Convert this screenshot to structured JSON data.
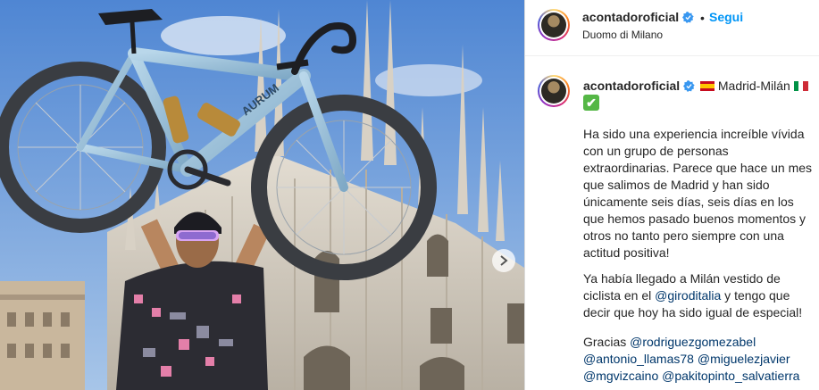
{
  "post": {
    "username": "acontadoroficial",
    "follow_label": "Segui",
    "separator": "•",
    "location": "Duomo di Milano"
  },
  "caption": {
    "username": "acontadoroficial",
    "title_text": "Madrid-Milán",
    "check_emoji": "✔",
    "paragraph1": "Ha sido una experiencia increíble vívida con un grupo de personas extraordinarias. Parece que hace un mes que salimos de Madrid y han sido únicamente seis días, seis días en los que hemos pasado buenos momentos y otros no tanto pero siempre con una actitud positiva!",
    "p2_before": "Ya había llegado a Milán vestido de ciclista en el ",
    "p2_mention": "@giroditalia",
    "p2_after": " y tengo que decir que hoy ha sido igual de especial!",
    "p3_label": "Gracias ",
    "mentions": [
      "@rodriguezgomezabel",
      "@antonio_llamas78",
      "@miguelezjavier",
      "@mgvizcaino",
      "@pakitopinto_salvatierra"
    ]
  },
  "photo": {
    "frame_text": "AURUM"
  },
  "colors": {
    "accent": "#0095f6",
    "verified": "#3897f0",
    "mention": "#00376b",
    "divider": "#dbdbdb"
  },
  "icons": {
    "verified": "verified-badge-icon",
    "next": "chevron-right-icon",
    "flag_spain": "spain-flag-icon",
    "flag_italy": "italy-flag-icon",
    "check": "check-mark-icon"
  }
}
